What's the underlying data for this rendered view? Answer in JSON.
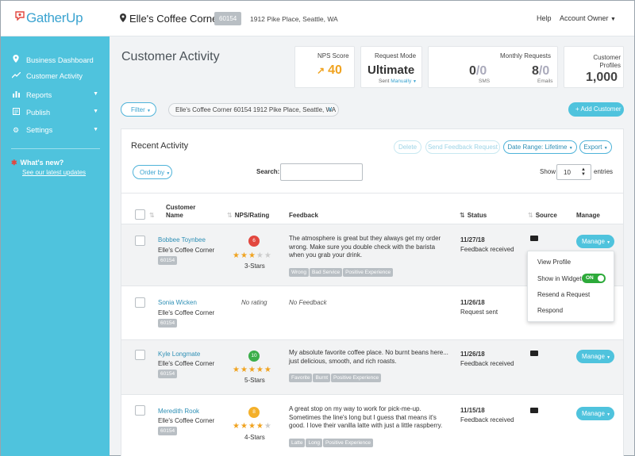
{
  "header": {
    "logo": "GatherUp",
    "location_name": "Elle's Coffee Corner",
    "location_id": "60154",
    "location_address": "1912 Pike Place, Seattle, WA",
    "help": "Help",
    "account": "Account Owner"
  },
  "sidebar": {
    "items": [
      {
        "label": "Business Dashboard",
        "icon": "map-pin-icon"
      },
      {
        "label": "Customer Activity",
        "icon": "trend-icon"
      },
      {
        "label": "Reports",
        "icon": "bar-chart-icon"
      },
      {
        "label": "Publish",
        "icon": "publish-icon"
      },
      {
        "label": "Settings",
        "icon": "gear-icon"
      }
    ],
    "whats_new": "What's new?",
    "updates_link": "See our latest updates"
  },
  "page": {
    "title": "Customer Activity"
  },
  "stats": {
    "nps_label": "NPS Score",
    "nps_value": "40",
    "mode_label": "Request Mode",
    "mode_value": "Ultimate",
    "mode_sub_prefix": "Sent",
    "mode_sub_link": "Manually",
    "monthly_label": "Monthly Requests",
    "sms_used": "0",
    "sms_total": "/0",
    "sms_label": "SMS",
    "email_used": "8",
    "email_total": "/0",
    "email_label": "Emails",
    "profiles_label": "Customer Profiles",
    "profiles_value": "1,000"
  },
  "filters": {
    "filter_label": "Filter",
    "chip": "Elle's Coffee Corner 60154 1912 Pike Place, Seattle, WA",
    "add_customer": "+ Add Customer"
  },
  "panel": {
    "title": "Recent Activity",
    "delete": "Delete",
    "send_feedback": "Send Feedback Request",
    "date_range": "Date Range: Lifetime",
    "export": "Export",
    "order_by": "Order by",
    "search_label": "Search:",
    "search_value": "",
    "show_label": "Show",
    "show_value": "10",
    "entries_label": "entries"
  },
  "table": {
    "headers": {
      "customer_name": "Customer Name",
      "nps": "NPS/Rating",
      "feedback": "Feedback",
      "status": "Status",
      "source": "Source",
      "manage": "Manage"
    },
    "rows": [
      {
        "name": "Bobbee Toynbee",
        "business": "Elle's Coffee Corner",
        "id": "60154",
        "nps": "6",
        "nps_color": "#e2473f",
        "stars": 3,
        "star_label": "3-Stars",
        "feedback": "The atmosphere is great but they always get my order wrong. Make sure you double check with the barista when you grab your drink.",
        "tags": [
          "Wrong",
          "Bad Service",
          "Positive Experience"
        ],
        "date": "11/27/18",
        "status": "Feedback received",
        "manage": "Manage"
      },
      {
        "name": "Sonia Wicken",
        "business": "Elle's Coffee Corner",
        "id": "60154",
        "no_rating": "No rating",
        "feedback": "No Feedback",
        "date": "11/26/18",
        "status": "Request sent"
      },
      {
        "name": "Kyle Longmate",
        "business": "Elle's Coffee Corner",
        "id": "60154",
        "nps": "10",
        "nps_color": "#3bae4a",
        "stars": 5,
        "star_label": "5-Stars",
        "feedback": "My absolute favorite coffee place. No burnt beans here... just delicious, smooth, and rich roasts.",
        "tags": [
          "Favorite",
          "Burnt",
          "Positive Experience"
        ],
        "date": "11/26/18",
        "status": "Feedback received",
        "manage": "Manage"
      },
      {
        "name": "Meredith Rook",
        "business": "Elle's Coffee Corner",
        "id": "60154",
        "nps": "8",
        "nps_color": "#f4b02a",
        "stars": 4,
        "star_label": "4-Stars",
        "feedback": "A great stop on my way to work for pick-me-up. Sometimes the line's long but I guess that means it's good. I love their vanilla latte with just a little raspberry.",
        "tags": [
          "Latte",
          "Long",
          "Positive Experience"
        ],
        "date": "11/15/18",
        "status": "Feedback received",
        "manage": "Manage"
      }
    ]
  },
  "manage_menu": {
    "view_profile": "View Profile",
    "show_in_widget": "Show in Widget",
    "toggle": "ON",
    "resend": "Resend a Request",
    "respond": "Respond"
  },
  "colors": {
    "accent": "#4fc3dd",
    "link": "#2e8fb5",
    "star": "#f0a320",
    "toggle_on": "#2daa3a"
  }
}
